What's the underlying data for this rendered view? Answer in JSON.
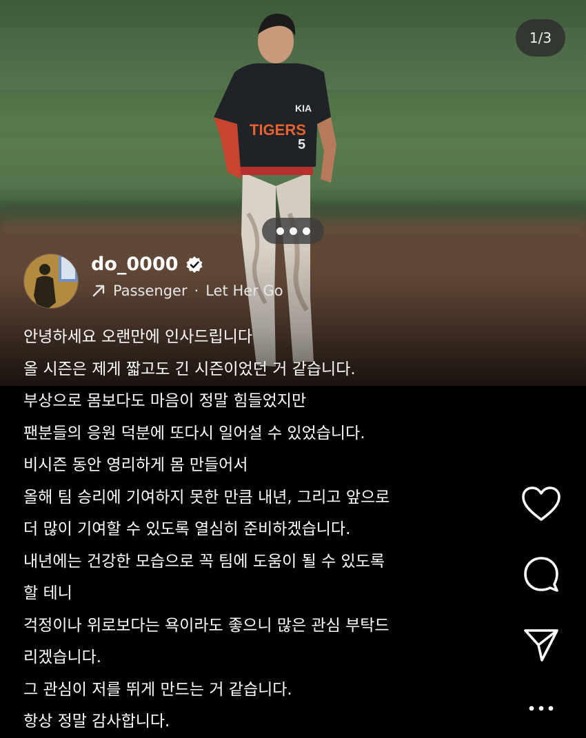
{
  "post": {
    "image_counter": "1/3",
    "username": "do_0000",
    "verified": true,
    "music": {
      "artist": "Passenger",
      "separator": "·",
      "song": "Let Her Go"
    },
    "caption_lines": [
      "안녕하세요 오랜만에 인사드립니다",
      "올 시즌은 제게 짧고도 긴 시즌이었던 거 같습니다.",
      "부상으로 몸보다도 마음이 정말 힘들었지만",
      "팬분들의 응원 덕분에 또다시 일어설 수 있었습니다.",
      "비시즌 동안 영리하게 몸 만들어서",
      "올해 팀 승리에 기여하지 못한 만큼 내년, 그리고 앞으로",
      "더 많이 기여할 수 있도록 열심히 준비하겠습니다.",
      "내년에는 건강한 모습으로 꼭 팀에 도움이 될 수 있도록",
      "할 테니",
      "걱정이나 위로보다는 욕이라도 좋으니 많은 관심 부탁드",
      "리겠습니다.",
      "그 관심이 저를 뛰게 만드는 거 같습니다.",
      "항상 정말 감사합니다."
    ],
    "jersey": {
      "team": "TIGERS",
      "number": "5",
      "sponsor": "KIA"
    }
  },
  "icons": [
    "heart-icon",
    "comment-icon",
    "share-icon",
    "more-icon",
    "verified-icon",
    "music-arrow-icon"
  ],
  "colors": {
    "background": "#000000",
    "text": "#ffffff",
    "verified_badge": "#ffffff"
  }
}
